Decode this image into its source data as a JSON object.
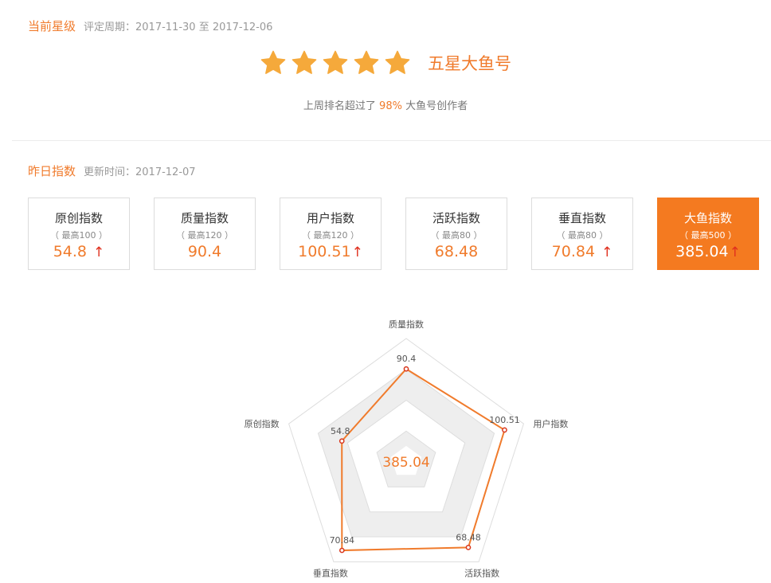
{
  "star_section": {
    "title": "当前星级",
    "period_label": "评定周期：2017-11-30 至 2017-12-06",
    "star_count": 5,
    "star_color": "#f5a93b",
    "level_name": "五星大鱼号",
    "rank_prefix": "上周排名超过了 ",
    "rank_percent": "98%",
    "rank_suffix": " 大鱼号创作者"
  },
  "index_section": {
    "title": "昨日指数",
    "update_label": "更新时间：2017-12-07"
  },
  "cards": [
    {
      "name": "原创指数",
      "max": "（ 最高100 ）",
      "value": "54.8",
      "arrow": "↑"
    },
    {
      "name": "质量指数",
      "max": "（ 最高120 ）",
      "value": "90.4",
      "arrow": ""
    },
    {
      "name": "用户指数",
      "max": "（ 最高120 ）",
      "value": "100.51",
      "arrow": "↑"
    },
    {
      "name": "活跃指数",
      "max": "（ 最高80 ）",
      "value": "68.48",
      "arrow": ""
    },
    {
      "name": "垂直指数",
      "max": "（ 最高80 ）",
      "value": "70.84",
      "arrow": "↑"
    },
    {
      "name": "大鱼指数",
      "max": "（ 最高500 ）",
      "value": "385.04",
      "arrow": "↑",
      "active": true
    }
  ],
  "colors": {
    "accent": "#f07b2c",
    "active_card": "#f47a20",
    "arrow_up": "#e0301e",
    "radar_band": "#eeeeee",
    "radar_line": "#f07b2c"
  },
  "chart_data": {
    "type": "radar",
    "center_label": "385.04",
    "axes": [
      {
        "name": "质量指数",
        "value": 90.4,
        "max": 120,
        "label": "90.4"
      },
      {
        "name": "用户指数",
        "value": 100.51,
        "max": 120,
        "label": "100.51"
      },
      {
        "name": "活跃指数",
        "value": 68.48,
        "max": 80,
        "label": "68.48"
      },
      {
        "name": "垂直指数",
        "value": 70.84,
        "max": 80,
        "label": "70.84"
      },
      {
        "name": "原创指数",
        "value": 54.8,
        "max": 100,
        "label": "54.8"
      }
    ],
    "rings": 4
  }
}
